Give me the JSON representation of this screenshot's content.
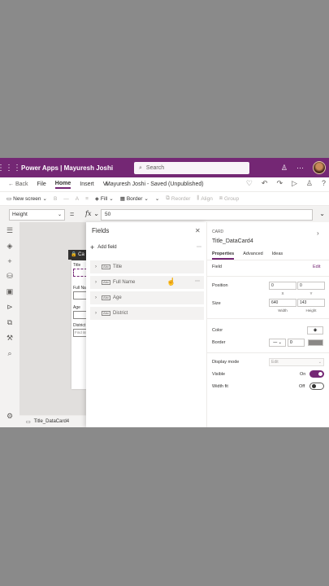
{
  "titlebar": {
    "app_title": "Power Apps  |  Mayuresh Joshi",
    "search_placeholder": "Search"
  },
  "menubar": {
    "back": "Back",
    "file": "File",
    "home": "Home",
    "insert": "Insert",
    "view_partial": "Vi",
    "saved_status": "Mayuresh Joshi - Saved (Unpublished)"
  },
  "toolbar": {
    "new_screen": "New screen",
    "fill": "Fill",
    "border": "Border",
    "reorder": "Reorder",
    "align": "Align",
    "group": "Group"
  },
  "formulabar": {
    "property": "Height",
    "equals": "=",
    "fx": "fx",
    "formula": "50"
  },
  "canvas": {
    "screen_tag": "Ca",
    "labels": [
      "Title",
      "Full Nam",
      "Age",
      "District"
    ],
    "find_text": "Find ite",
    "status_control": "Title_DataCard4"
  },
  "fields_pane": {
    "title": "Fields",
    "add_field": "Add field",
    "fields": [
      {
        "label": "Title",
        "type": "Abc"
      },
      {
        "label": "Full Name",
        "type": "Abc"
      },
      {
        "label": "Age",
        "type": "Abc"
      },
      {
        "label": "District",
        "type": "Abc"
      }
    ]
  },
  "properties_pane": {
    "card_type": "CARD",
    "card_name": "Title_DataCard4",
    "tabs": [
      "Properties",
      "Advanced",
      "Ideas"
    ],
    "field_label": "Field",
    "edit": "Edit",
    "position_label": "Position",
    "position_x": "0",
    "position_y": "0",
    "x_label": "X",
    "y_label": "Y",
    "size_label": "Size",
    "width": "640",
    "height": "143",
    "width_label": "Width",
    "height_label": "Height",
    "color_label": "Color",
    "border_label": "Border",
    "border_width": "0",
    "display_mode_label": "Display mode",
    "display_mode_value": "Edit",
    "visible_label": "Visible",
    "visible_state": "On",
    "width_fit_label": "Width fit",
    "width_fit_state": "Off"
  },
  "colors": {
    "brand": "#742774",
    "canvas": "#e1dfdd",
    "background": "#8a8a8a"
  }
}
